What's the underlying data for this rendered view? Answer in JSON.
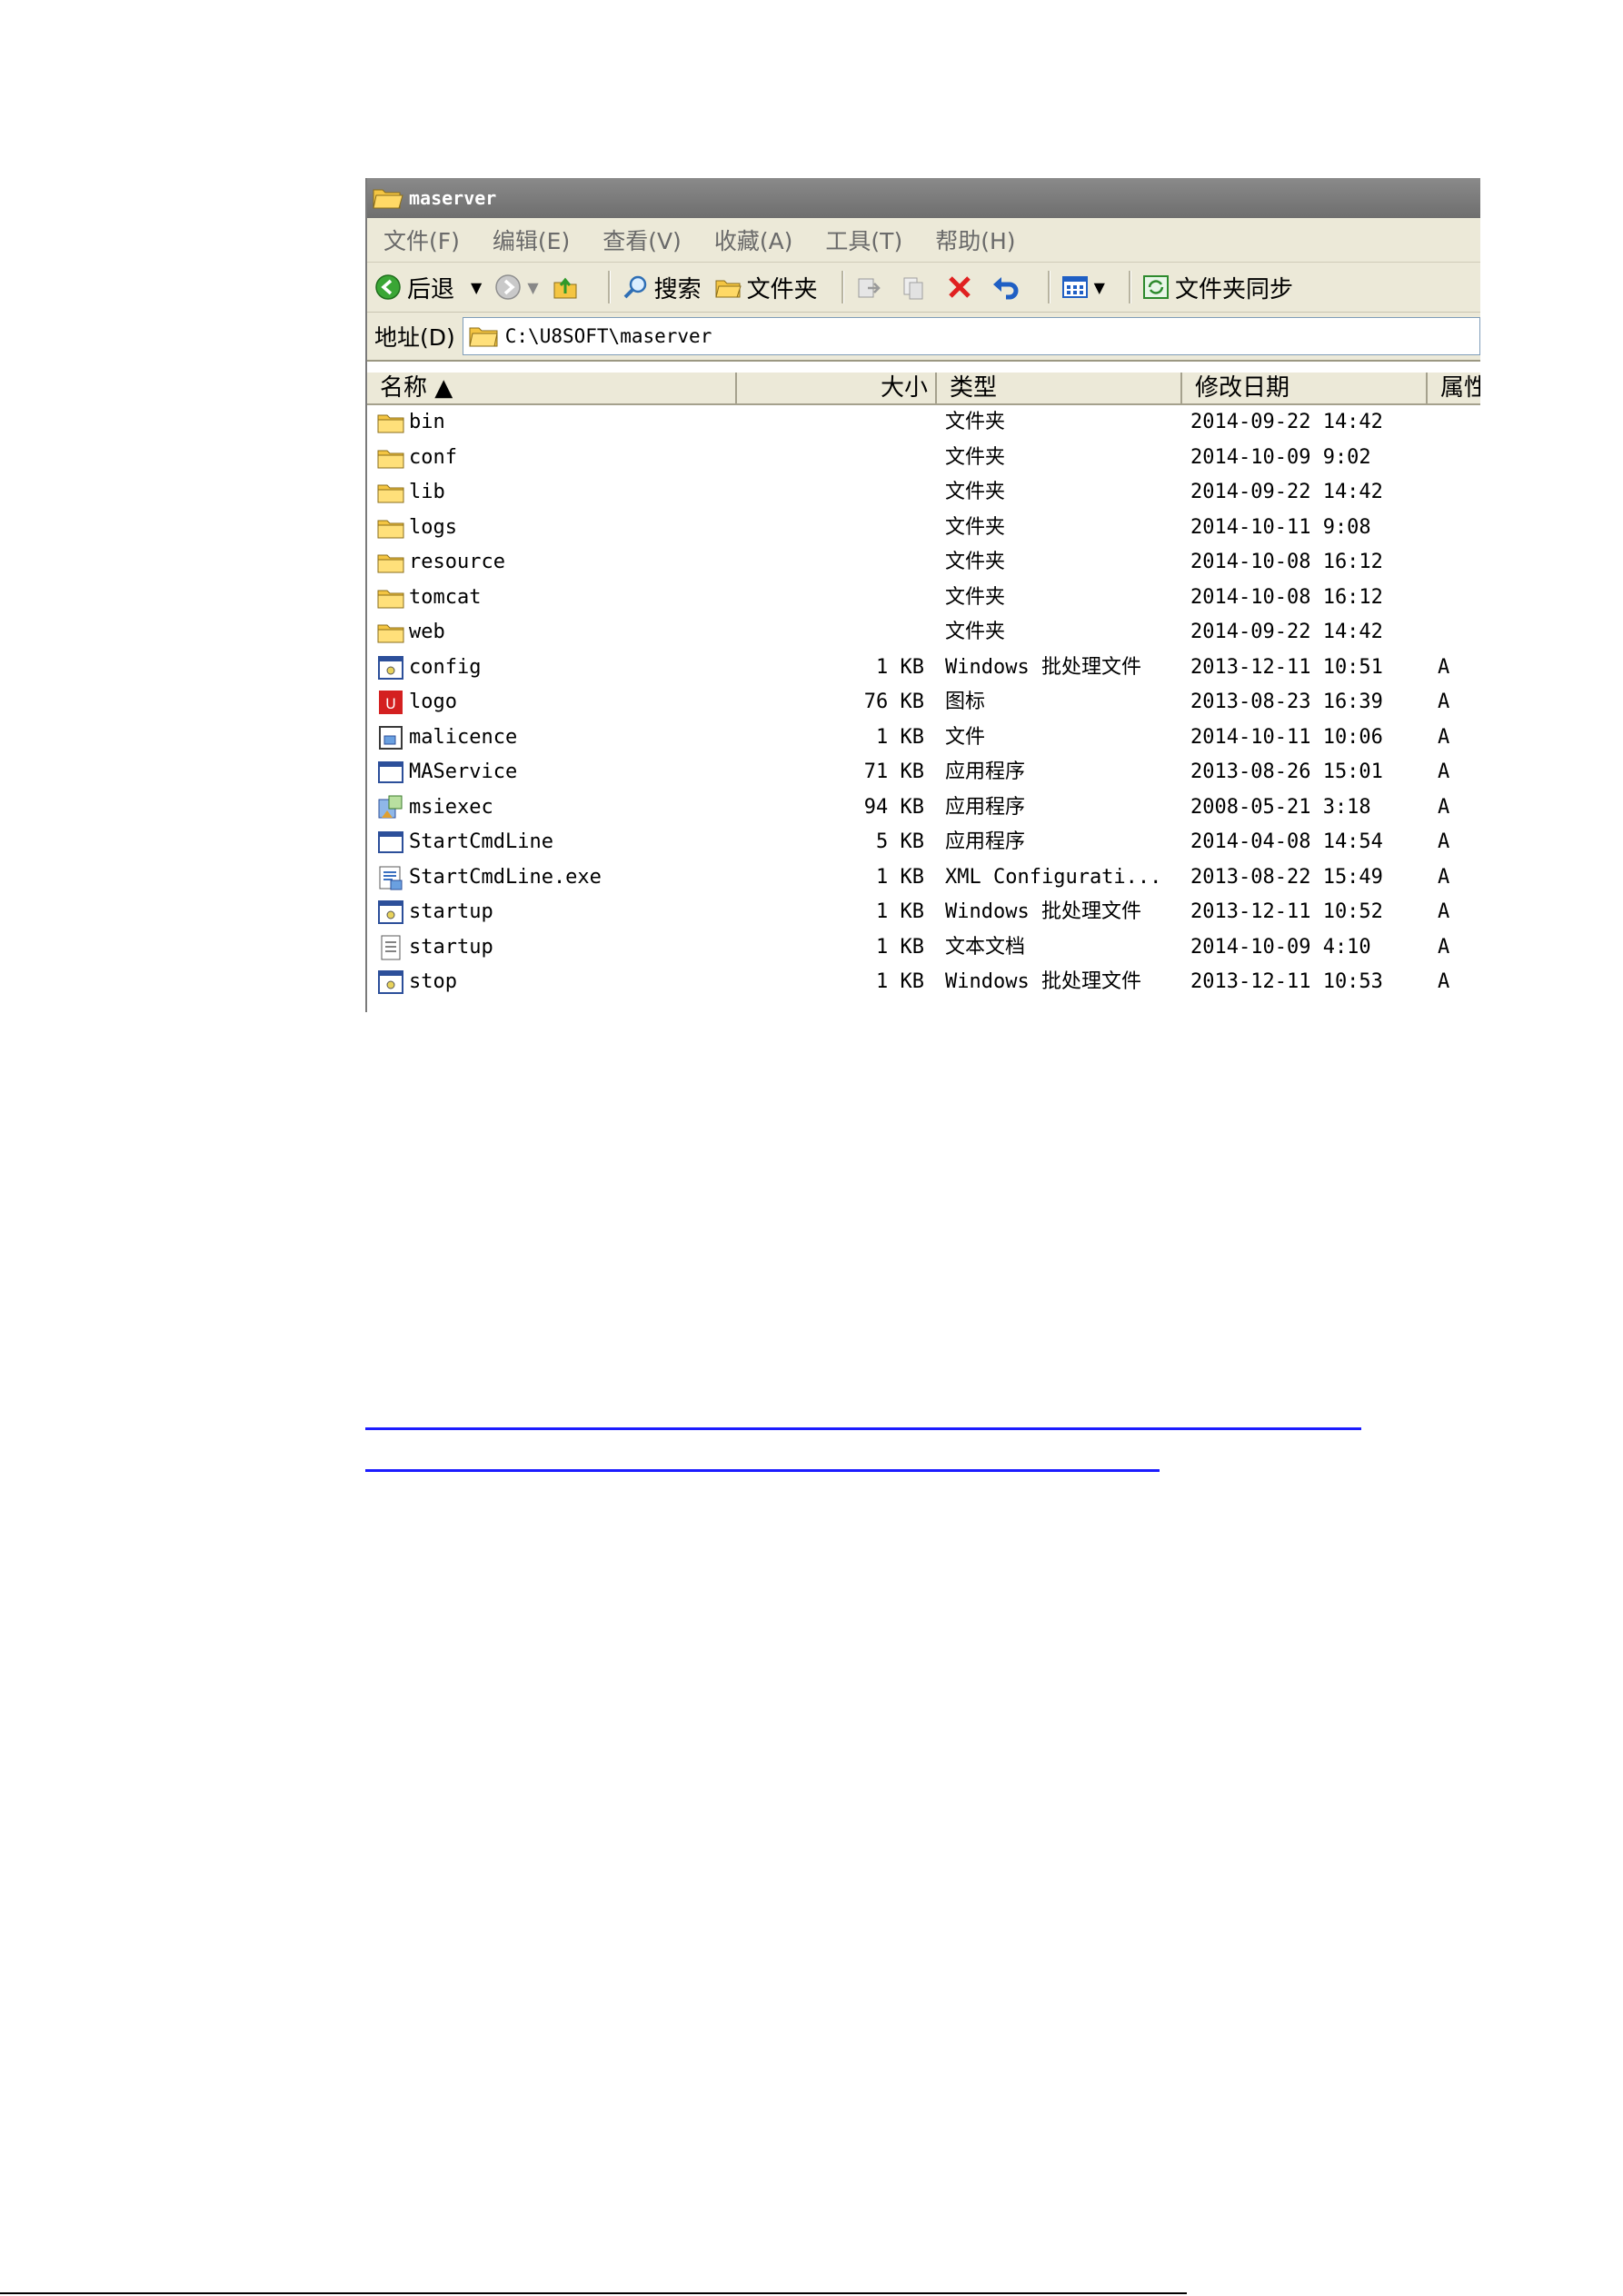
{
  "window": {
    "title": "maserver",
    "menu": [
      "文件(F)",
      "编辑(E)",
      "查看(V)",
      "收藏(A)",
      "工具(T)",
      "帮助(H)"
    ],
    "toolbar": {
      "back": "后退",
      "search": "搜索",
      "folders": "文件夹",
      "sync": "文件夹同步"
    },
    "address": {
      "label": "地址(D)",
      "value": "C:\\U8SOFT\\maserver"
    },
    "columns": [
      "名称 ▲",
      "大小",
      "类型",
      "修改日期",
      "属性"
    ],
    "files": [
      {
        "name": "bin",
        "size": "",
        "type": "文件夹",
        "date": "2014-09-22 14:42",
        "attr": "",
        "icon": "folder-icon"
      },
      {
        "name": "conf",
        "size": "",
        "type": "文件夹",
        "date": "2014-10-09 9:02",
        "attr": "",
        "icon": "folder-icon"
      },
      {
        "name": "lib",
        "size": "",
        "type": "文件夹",
        "date": "2014-09-22 14:42",
        "attr": "",
        "icon": "folder-icon"
      },
      {
        "name": "logs",
        "size": "",
        "type": "文件夹",
        "date": "2014-10-11 9:08",
        "attr": "",
        "icon": "folder-icon"
      },
      {
        "name": "resource",
        "size": "",
        "type": "文件夹",
        "date": "2014-10-08 16:12",
        "attr": "",
        "icon": "folder-icon"
      },
      {
        "name": "tomcat",
        "size": "",
        "type": "文件夹",
        "date": "2014-10-08 16:12",
        "attr": "",
        "icon": "folder-icon"
      },
      {
        "name": "web",
        "size": "",
        "type": "文件夹",
        "date": "2014-09-22 14:42",
        "attr": "",
        "icon": "folder-icon"
      },
      {
        "name": "config",
        "size": "1 KB",
        "type": "Windows 批处理文件",
        "date": "2013-12-11 10:51",
        "attr": "A",
        "icon": "batch-file-icon"
      },
      {
        "name": "logo",
        "size": "76 KB",
        "type": "图标",
        "date": "2013-08-23 16:39",
        "attr": "A",
        "icon": "app-logo-icon"
      },
      {
        "name": "malicence",
        "size": "1 KB",
        "type": "文件",
        "date": "2014-10-11 10:06",
        "attr": "A",
        "icon": "generic-file-icon"
      },
      {
        "name": "MAService",
        "size": "71 KB",
        "type": "应用程序",
        "date": "2013-08-26 15:01",
        "attr": "A",
        "icon": "application-icon"
      },
      {
        "name": "msiexec",
        "size": "94 KB",
        "type": "应用程序",
        "date": "2008-05-21 3:18",
        "attr": "A",
        "icon": "installer-icon"
      },
      {
        "name": "StartCmdLine",
        "size": "5 KB",
        "type": "应用程序",
        "date": "2014-04-08 14:54",
        "attr": "A",
        "icon": "application-icon"
      },
      {
        "name": "StartCmdLine.exe",
        "size": "1 KB",
        "type": "XML Configurati...",
        "date": "2013-08-22 15:49",
        "attr": "A",
        "icon": "xml-config-icon"
      },
      {
        "name": "startup",
        "size": "1 KB",
        "type": "Windows 批处理文件",
        "date": "2013-12-11 10:52",
        "attr": "A",
        "icon": "batch-file-icon"
      },
      {
        "name": "startup",
        "size": "1 KB",
        "type": "文本文档",
        "date": "2014-10-09 4:10",
        "attr": "A",
        "icon": "text-file-icon"
      },
      {
        "name": "stop",
        "size": "1 KB",
        "type": "Windows 批处理文件",
        "date": "2013-12-11 10:53",
        "attr": "A",
        "icon": "batch-file-icon"
      }
    ]
  }
}
